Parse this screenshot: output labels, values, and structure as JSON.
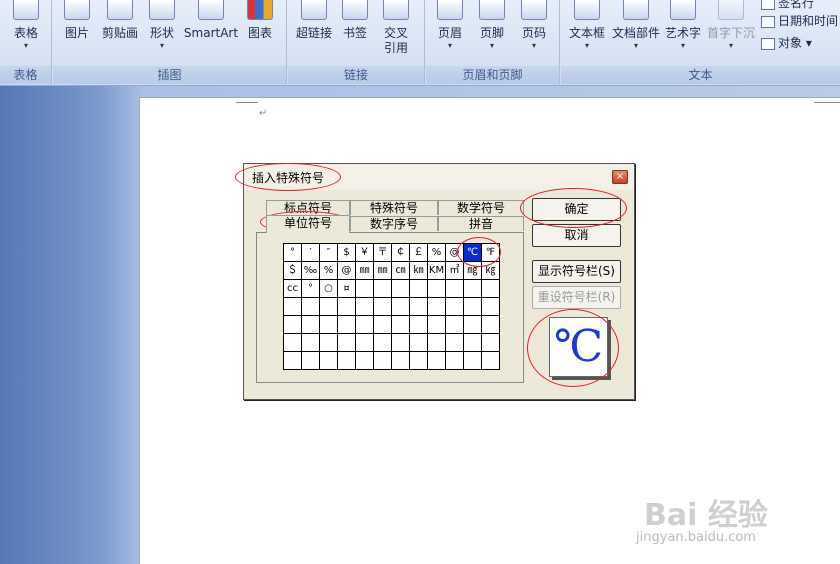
{
  "ribbon": {
    "groups": [
      {
        "label": "表格",
        "buttons": [
          {
            "label": "表格",
            "arrow": "▾"
          }
        ]
      },
      {
        "label": "插图",
        "buttons": [
          {
            "label": "图片",
            "arrow": ""
          },
          {
            "label": "剪贴画",
            "arrow": ""
          },
          {
            "label": "形状",
            "arrow": "▾"
          },
          {
            "label": "SmartArt",
            "arrow": ""
          },
          {
            "label": "图表",
            "arrow": ""
          }
        ]
      },
      {
        "label": "链接",
        "buttons": [
          {
            "label": "超链接",
            "arrow": ""
          },
          {
            "label": "书签",
            "arrow": ""
          },
          {
            "label": "交叉\n引用",
            "arrow": ""
          }
        ]
      },
      {
        "label": "页眉和页脚",
        "buttons": [
          {
            "label": "页眉",
            "arrow": "▾"
          },
          {
            "label": "页脚",
            "arrow": "▾"
          },
          {
            "label": "页码",
            "arrow": "▾"
          }
        ]
      },
      {
        "label": "文本",
        "buttons": [
          {
            "label": "文本框",
            "arrow": "▾"
          },
          {
            "label": "文档部件",
            "arrow": "▾"
          },
          {
            "label": "艺术字",
            "arrow": "▾"
          },
          {
            "label": "首字下沉",
            "arrow": "▾"
          }
        ],
        "small_items": [
          "签名行",
          "日期和时间",
          "对象 ▾"
        ]
      }
    ]
  },
  "dialog": {
    "title": "插入特殊符号",
    "close_glyph": "×",
    "tabs_row1": [
      "标点符号",
      "特殊符号",
      "数学符号"
    ],
    "tabs_row2": [
      "单位符号",
      "数字序号",
      "拼音"
    ],
    "active_tab": "单位符号",
    "symbols": [
      [
        "°",
        "′",
        "″",
        "$",
        "￥",
        "〒",
        "￠",
        "￡",
        "%",
        "@",
        "℃",
        "℉"
      ],
      [
        "＄",
        "‰",
        "%",
        "@",
        "㎜",
        "㎜",
        "㎝",
        "㎞",
        "KM",
        "㎡",
        "㎎",
        "㎏"
      ],
      [
        "cc",
        "°",
        "○",
        "¤",
        "",
        "",
        "",
        "",
        "",
        "",
        "",
        ""
      ],
      [
        "",
        "",
        "",
        "",
        "",
        "",
        "",
        "",
        "",
        "",
        "",
        ""
      ],
      [
        "",
        "",
        "",
        "",
        "",
        "",
        "",
        "",
        "",
        "",
        "",
        ""
      ],
      [
        "",
        "",
        "",
        "",
        "",
        "",
        "",
        "",
        "",
        "",
        "",
        ""
      ],
      [
        "",
        "",
        "",
        "",
        "",
        "",
        "",
        "",
        "",
        "",
        "",
        ""
      ]
    ],
    "selected_symbol": "℃",
    "buttons": {
      "ok": "确定",
      "cancel": "取消",
      "show_bar": "显示符号栏(S)",
      "reset_bar": "重设符号栏(R)"
    },
    "preview": "℃"
  },
  "watermark": {
    "logo": "Bai 经验",
    "url": "jingyan.baidu.com"
  },
  "colors": {
    "annotation": "#e0202a",
    "selection": "#0a2bd8",
    "preview_text": "#1a3ad8"
  }
}
